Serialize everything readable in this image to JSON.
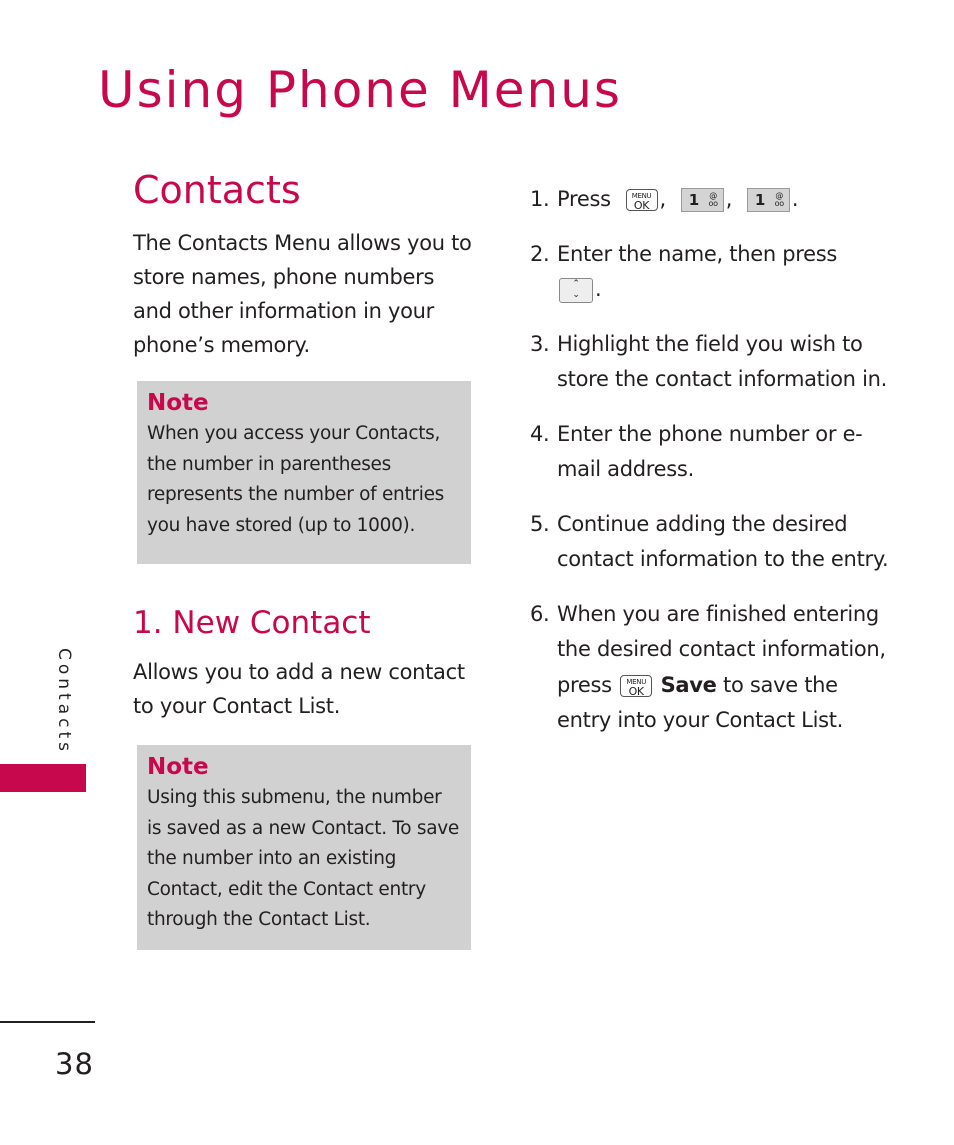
{
  "header": {
    "title": "Using Phone Menus"
  },
  "section": {
    "title": "Contacts",
    "intro": "The Contacts Menu allows you to store names, phone numbers and other information in your phone’s memory.",
    "note": {
      "title": "Note",
      "body": "When you access your Contacts, the number in parentheses represents the number of entries you have stored (up to 1000)."
    }
  },
  "subsection": {
    "title": "1. New Contact",
    "description": "Allows you to add a new contact to your Contact List.",
    "note": {
      "title": "Note",
      "body": "Using this submenu, the number is saved as a new Contact. To save the number into an existing Contact, edit the Contact entry through the Contact List."
    }
  },
  "keys": {
    "menu_ok": {
      "icon": "menu-ok-key-icon",
      "top": "MENU",
      "bottom": "OK"
    },
    "one": {
      "icon": "one-key-icon",
      "digit": "1",
      "symbol_top": "@",
      "symbol_bottom": "oo"
    },
    "nav": {
      "icon": "nav-up-down-key-icon",
      "up": "⌃",
      "down": "⌄"
    }
  },
  "steps": [
    {
      "num": "1.",
      "text_before": "Press",
      "sep1": ",",
      "sep2": ",",
      "end": "."
    },
    {
      "num": "2.",
      "text": "Enter the name, then press",
      "end": "."
    },
    {
      "num": "3.",
      "text": "Highlight the field you wish to store the contact information in."
    },
    {
      "num": "4.",
      "text": "Enter the phone number or e-mail address."
    },
    {
      "num": "5.",
      "text": "Continue adding the desired contact information to the entry."
    },
    {
      "num": "6.",
      "text_before": "When you are finished entering the desired contact information, press",
      "bold": "Save",
      "text_after": "to save the entry into your Contact List."
    }
  ],
  "sidebar": {
    "label": "Contacts",
    "accent": "#c8084c"
  },
  "footer": {
    "page_number": "38"
  }
}
